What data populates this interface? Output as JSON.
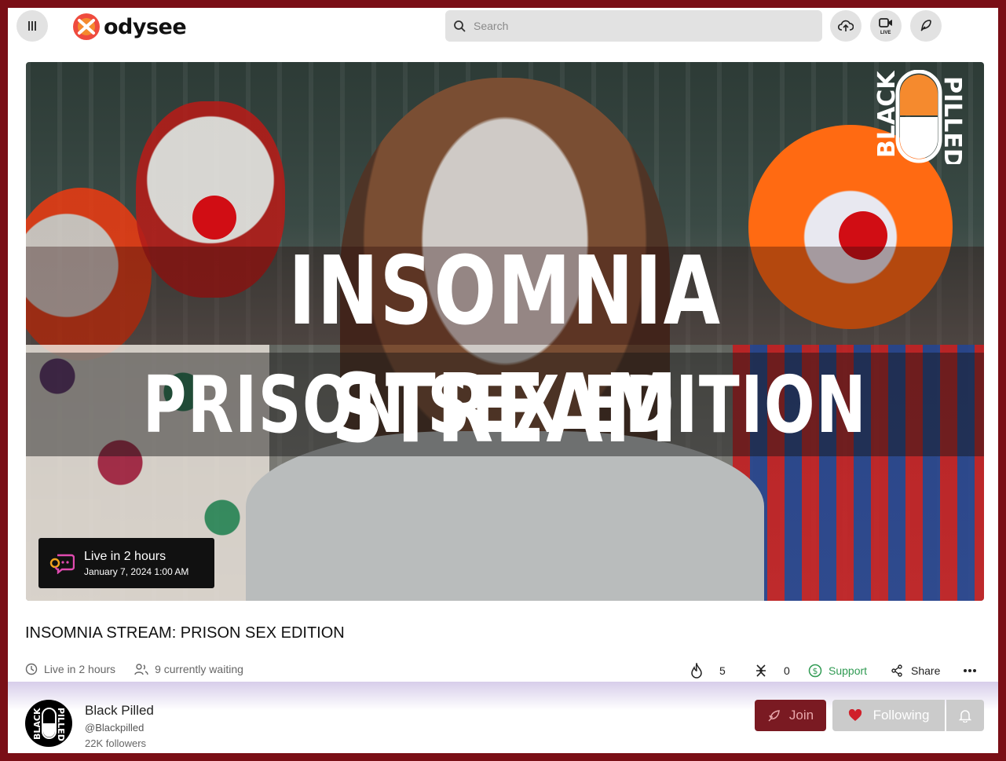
{
  "header": {
    "logo_text": "odysee",
    "search_placeholder": "Search",
    "live_button_label": "LIVE"
  },
  "thumbnail": {
    "title_line1": "INSOMNIA STREAM",
    "title_line2": "PRISON SEX EDITION",
    "brand_word_left": "BLACK",
    "brand_word_right": "PILLED",
    "live_badge": {
      "status": "Live in 2 hours",
      "date": "January 7, 2024 1:00 AM"
    }
  },
  "video": {
    "title": "INSOMNIA STREAM: PRISON SEX EDITION",
    "live_status": "Live in 2 hours",
    "waiting": "9 currently waiting",
    "fire_count": "5",
    "slime_count": "0",
    "support_label": "Support",
    "share_label": "Share"
  },
  "channel": {
    "name": "Black Pilled",
    "handle": "@Blackpilled",
    "followers": "22K followers",
    "join_label": "Join",
    "following_label": "Following",
    "avatar_word_left": "BLACK",
    "avatar_word_right": "PILLED"
  },
  "colors": {
    "page_border": "#7a0f16",
    "accent_red": "#d0202a",
    "support_green": "#2f9a52",
    "join_bg": "#7a1a22"
  },
  "icons": [
    "menu-icon",
    "odysee-logo-icon",
    "search-icon",
    "upload-icon",
    "go-live-icon",
    "publish-icon",
    "clock-icon",
    "people-icon",
    "fire-icon",
    "slime-icon",
    "support-dollar-icon",
    "share-icon",
    "more-icon",
    "rocket-icon",
    "heart-icon",
    "bell-icon"
  ]
}
